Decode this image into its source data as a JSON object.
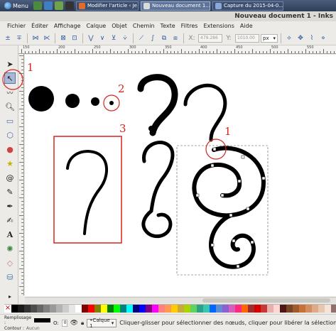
{
  "taskbar": {
    "menu_label": "Menu",
    "windows": [
      {
        "label": "Modifier l'article ‹ Je ..."
      },
      {
        "label": "Nouveau document 1..."
      },
      {
        "label": "Capture du 2015-04-0..."
      }
    ]
  },
  "window": {
    "title": "Nouveau document 1 - Inks"
  },
  "menubar": {
    "items": [
      "Fichier",
      "Éditer",
      "Affichage",
      "Calque",
      "Objet",
      "Chemin",
      "Texte",
      "Filtres",
      "Extensions",
      "Aide"
    ]
  },
  "toolbar": {
    "x_value": "479.286",
    "y_value": "1010.00",
    "unit": "px"
  },
  "ruler": {
    "labels": [
      "150",
      "200",
      "250",
      "300",
      "350",
      "400",
      "450",
      "500",
      "550"
    ]
  },
  "annotations": {
    "node_tool_marker": "1",
    "canvas_marker_1": "1",
    "canvas_marker_2": "2",
    "canvas_marker_3": "3",
    "color": "#d8241c"
  },
  "palette": {
    "colors": [
      "#000000",
      "#1a1a1a",
      "#333333",
      "#4d4d4d",
      "#666666",
      "#808080",
      "#999999",
      "#b3b3b3",
      "#cccccc",
      "#e6e6e6",
      "#ffffff",
      "#800000",
      "#ff0000",
      "#808000",
      "#ffff00",
      "#008000",
      "#00ff00",
      "#008080",
      "#00ffff",
      "#000080",
      "#0000ff",
      "#800080",
      "#ff00ff",
      "#ff8080",
      "#ff9955",
      "#ffcc00",
      "#c8ab37",
      "#aad400",
      "#5fd35f",
      "#2ca089",
      "#37c8ab",
      "#0066ff",
      "#5f8dd3",
      "#8d5fd3",
      "#d35fbc",
      "#ff2a7f",
      "#ff6600",
      "#a02c2c",
      "#d40000",
      "#c83737",
      "#e9afaf",
      "#ffd5d5",
      "#501616",
      "#784421",
      "#a05a2c",
      "#c87137",
      "#d38d5f",
      "#deaa87",
      "#e9c6af",
      "#f4e3d7",
      "#916f6f",
      "#ac9393"
    ]
  },
  "statusbar": {
    "fill_label": "Remplissage :",
    "stroke_label": "Contour :",
    "stroke_value": "Aucun",
    "opacity_value": "0",
    "layer": "•Calque 1",
    "message": "Cliquer-glisser pour sélectionner des nœuds, cliquer pour libérer la sélection"
  }
}
